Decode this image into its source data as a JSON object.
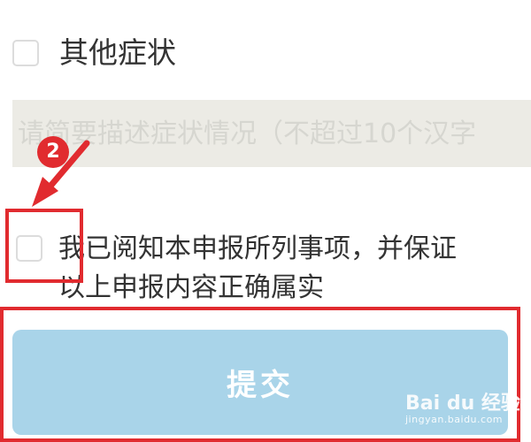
{
  "symptoms": {
    "other_label": "其他症状",
    "description_placeholder": "请简要描述症状情况（不超过10个汉字",
    "description_value": ""
  },
  "agreement": {
    "line1": "我已阅知本申报所列事项，并保证",
    "line2": "以上申报内容正确属实",
    "checked": false
  },
  "submit": {
    "label": "提交"
  },
  "annotation": {
    "step_number": "2",
    "color": "#e12b2f"
  },
  "watermark": {
    "brand": "Bai du 经验",
    "url": "jingyan.baidu.com"
  },
  "colors": {
    "submit_bg": "#a9d4e9",
    "input_bg": "#ecebe5",
    "text": "#333333"
  }
}
